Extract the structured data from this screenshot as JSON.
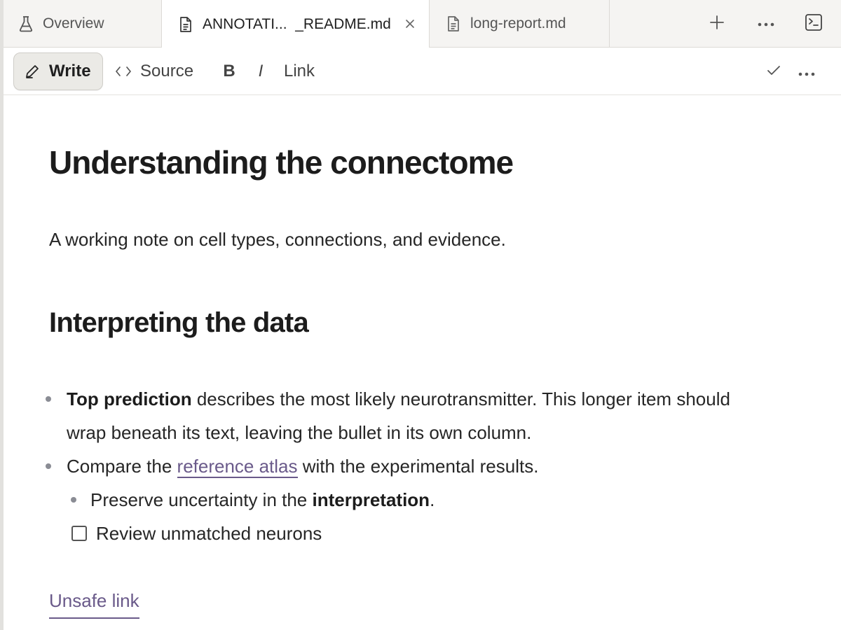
{
  "tabs": {
    "overview": {
      "label": "Overview",
      "icon": "flask-icon"
    },
    "annotation": {
      "label": "ANNOTATI...  _README.md",
      "icon": "document-icon",
      "active": true
    },
    "long_report": {
      "label": "long-report.md",
      "icon": "document-icon"
    }
  },
  "toolbar": {
    "write_label": "Write",
    "source_label": "Source",
    "bold_label": "B",
    "italic_label": "I",
    "link_label": "Link"
  },
  "document": {
    "title": "Understanding the connectome",
    "subtitle": "A working note on cell types, connections, and evidence.",
    "section_heading": "Interpreting the data",
    "item1": {
      "bold": "Top prediction",
      "text": " describes the most likely neurotransmitter. This longer item should wrap beneath its text, leaving the bullet in its own column."
    },
    "item2": {
      "before": "Compare the ",
      "link": "reference atlas",
      "after": " with the experimental results."
    },
    "item3": {
      "before": "Preserve uncertainty in the ",
      "bold": "interpretation",
      "after": "."
    },
    "task": {
      "label": "Review unmatched neurons",
      "checked": false
    },
    "unsafe_link": "Unsafe link"
  },
  "colors": {
    "link": "#6a5a8a",
    "active_button_bg": "#ebeae6",
    "tabbar_bg": "#f5f4f2"
  }
}
